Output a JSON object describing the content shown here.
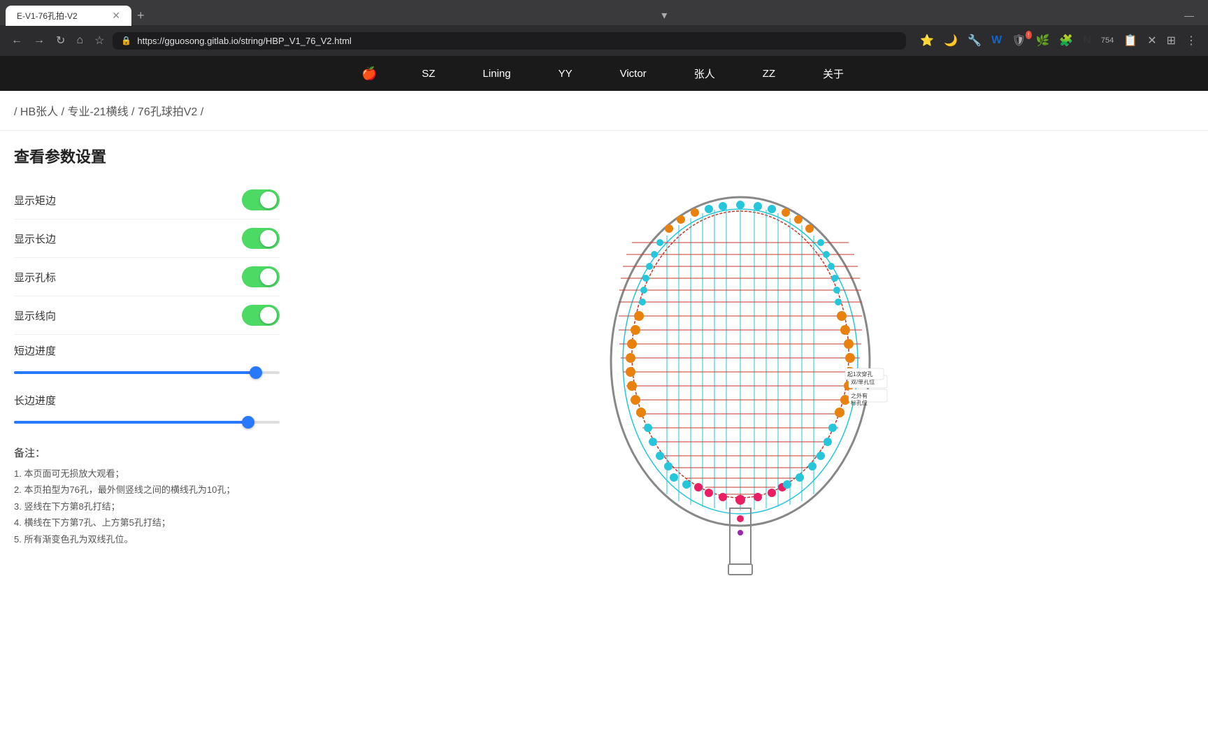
{
  "browser": {
    "tab_title": "E-V1-76孔拍-V2",
    "url": "https://gguosong.gitlab.io/string/HBP_V1_76_V2.html",
    "new_tab_label": "+"
  },
  "navbar": {
    "logo": "🍎",
    "items": [
      "SZ",
      "Lining",
      "YY",
      "Victor",
      "张人",
      "ZZ",
      "关于"
    ]
  },
  "breadcrumb": {
    "text": "/ HB张人 / 专业-21横线 / 76孔球拍V2 /"
  },
  "settings_panel": {
    "title": "查看参数设置",
    "settings": [
      {
        "label": "显示矩边",
        "enabled": true
      },
      {
        "label": "显示长边",
        "enabled": true
      },
      {
        "label": "显示孔标",
        "enabled": true
      },
      {
        "label": "显示线向",
        "enabled": true
      }
    ],
    "short_side_progress_label": "短边进度",
    "long_side_progress_label": "长边进度",
    "notes_label": "备注：",
    "notes": [
      "1. 本页面可无损放大观看；",
      "2. 本页拍型为76孔，最外侧竖线之间的横线孔为10孔；",
      "3. 竖线在下方第8孔打结；",
      "4. 横线在下方第7孔、上方第5孔打结；",
      "5. 所有渐变色孔为双线孔位。"
    ]
  },
  "colors": {
    "nav_bg": "#1a1a1a",
    "blue": "#2979ff",
    "green": "#4cd964",
    "red": "#cc0000",
    "orange": "#e8820c",
    "teal": "#26c6da",
    "pink": "#e91e63",
    "purple": "#9c27b0"
  }
}
